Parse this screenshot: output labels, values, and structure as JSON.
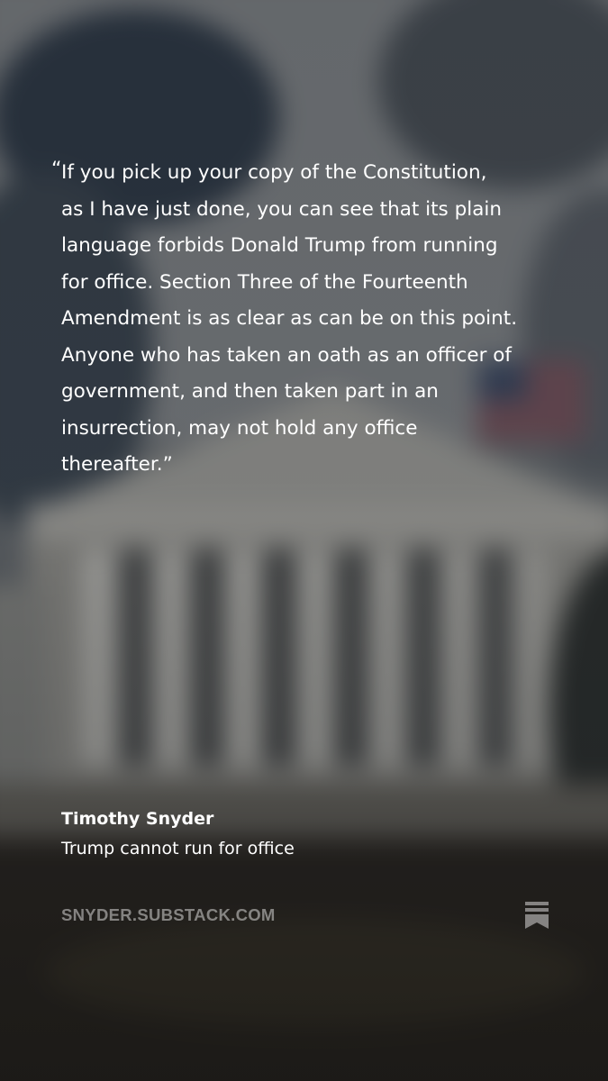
{
  "quote": {
    "open_mark": "“",
    "text": "If you pick up your copy of the Constitution,\nas I have just done, you can see that its plain\nlanguage forbids Donald Trump from running\nfor office. Section Three of the Fourteenth\nAmendment is as clear as can be on this point.\nAnyone who has taken an oath as an officer of\ngovernment, and then taken part in an\ninsurrection, may not hold any office\nthereafter.”"
  },
  "byline": {
    "author": "Timothy Snyder",
    "post_title": "Trump cannot run for office"
  },
  "footer": {
    "domain": "SNYDER.SUBSTACK.COM",
    "logo_icon": "substack-bookmark-icon"
  },
  "colors": {
    "text": "#ffffff",
    "footer_text": "rgba(255,255,255,0.45)"
  }
}
